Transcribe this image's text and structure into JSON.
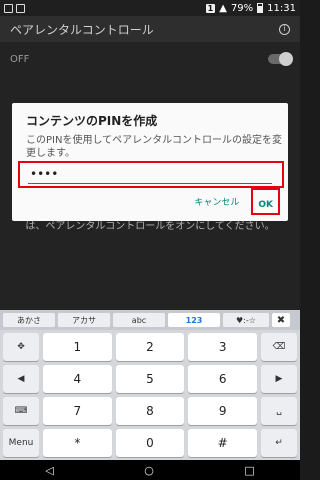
{
  "status": {
    "sim_badge": "1",
    "battery": "79%",
    "time": "11:31"
  },
  "app_bar": {
    "title": "ペアレンタルコントロール"
  },
  "content": {
    "off_label": "OFF",
    "background_text_line1": "は、ペアレンタルコントロールをオンにしてください。"
  },
  "dialog": {
    "title": "コンテンツのPINを作成",
    "message": "このPINを使用してペアレンタルコントロールの設定を変更します。",
    "pin_value": "••••",
    "cancel_label": "キャンセル",
    "ok_label": "OK"
  },
  "colors": {
    "accent": "#00897b",
    "highlight": "#e60012"
  },
  "keyboard": {
    "tabs": [
      {
        "label": "あかさ"
      },
      {
        "label": "アカサ"
      },
      {
        "label": "abc"
      },
      {
        "label": "123"
      },
      {
        "label": "♥:-☆"
      }
    ],
    "close_label": "✖",
    "keys": {
      "move": "✥",
      "k1": "1",
      "k2": "2",
      "k3": "3",
      "backspace": "⌫",
      "left": "◀",
      "k4": "4",
      "k5": "5",
      "k6": "6",
      "right": "▶",
      "kbd": "⌨",
      "k7": "7",
      "k8": "8",
      "k9": "9",
      "space": "␣",
      "menu": "Menu",
      "star": "*",
      "k0": "0",
      "hash": "#",
      "enter": "↵"
    }
  },
  "nav": {
    "back": "◁",
    "home": "○",
    "recent": "□"
  }
}
